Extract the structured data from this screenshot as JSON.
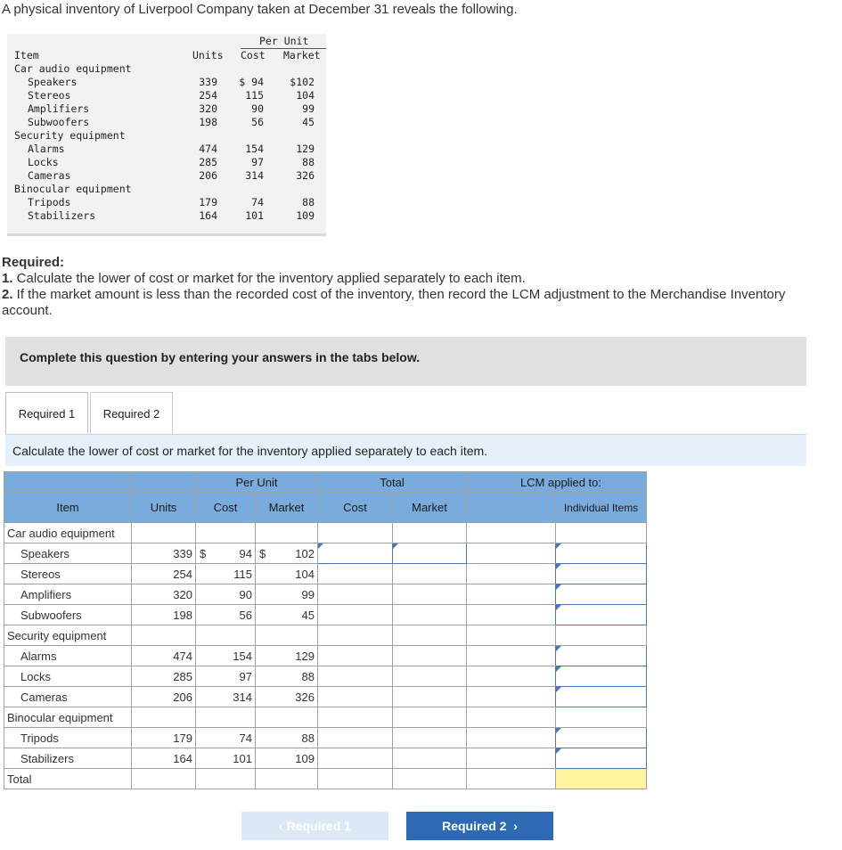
{
  "intro": "A physical inventory of Liverpool Company taken at December 31 reveals the following.",
  "source": {
    "h_per_unit": "Per Unit",
    "h_item": "Item",
    "h_units": "Units",
    "h_cost": "Cost",
    "h_market": "Market",
    "rows": [
      {
        "label": "Car audio equipment",
        "group": true
      },
      {
        "label": "Speakers",
        "units": "339",
        "cost": "$ 94",
        "market": "$102"
      },
      {
        "label": "Stereos",
        "units": "254",
        "cost": "115",
        "market": "104"
      },
      {
        "label": "Amplifiers",
        "units": "320",
        "cost": "90",
        "market": "99"
      },
      {
        "label": "Subwoofers",
        "units": "198",
        "cost": "56",
        "market": "45"
      },
      {
        "label": "Security equipment",
        "group": true
      },
      {
        "label": "Alarms",
        "units": "474",
        "cost": "154",
        "market": "129"
      },
      {
        "label": "Locks",
        "units": "285",
        "cost": "97",
        "market": "88"
      },
      {
        "label": "Cameras",
        "units": "206",
        "cost": "314",
        "market": "326"
      },
      {
        "label": "Binocular equipment",
        "group": true
      },
      {
        "label": "Tripods",
        "units": "179",
        "cost": "74",
        "market": "88"
      },
      {
        "label": "Stabilizers",
        "units": "164",
        "cost": "101",
        "market": "109"
      }
    ]
  },
  "required": {
    "heading": "Required:",
    "item1_num": "1.",
    "item1": " Calculate the lower of cost or market for the inventory applied separately to each item.",
    "item2_num": "2.",
    "item2": " If the market amount is less than the recorded cost of the inventory, then record the LCM adjustment to the Merchandise Inventory account."
  },
  "banner": "Complete this question by entering your answers in the tabs below.",
  "tabs": [
    "Required 1",
    "Required 2"
  ],
  "instruction": "Calculate the lower of cost or market for the inventory applied separately to each item.",
  "table": {
    "h_per_unit": "Per Unit",
    "h_total": "Total",
    "h_lcm": "LCM applied to:",
    "h_item": "Item",
    "h_units": "Units",
    "h_cost": "Cost",
    "h_market": "Market",
    "h_total_cost": "Cost",
    "h_total_market": "Market",
    "h_individual": "Individual Items",
    "dollar": "$",
    "total_label": "Total"
  },
  "nav": {
    "prev": "Required 1",
    "next": "Required 2"
  }
}
